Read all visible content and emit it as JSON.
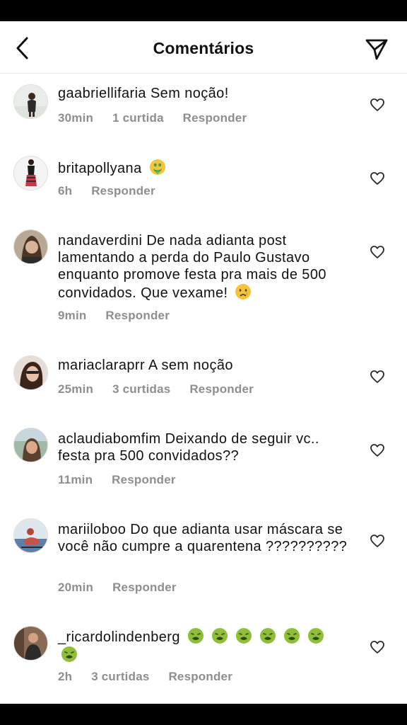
{
  "header": {
    "title": "Comentários",
    "back_icon": "chevron-left-icon",
    "send_icon": "paper-plane-icon"
  },
  "comments": [
    {
      "username": "gaabriellifaria",
      "text": "Sem noção!",
      "emoji": [],
      "time": "30min",
      "likes": "1 curtida",
      "reply": "Responder"
    },
    {
      "username": "britapollyana",
      "text": "",
      "emoji": [
        "money-mouth-face"
      ],
      "time": "6h",
      "likes": "",
      "reply": "Responder"
    },
    {
      "username": "nandaverdini",
      "text": "De nada adianta post lamentando a perda do Paulo Gustavo enquanto promove festa pra mais de 500 convidados. Que vexame!",
      "emoji": [
        "crying-face"
      ],
      "time": "9min",
      "likes": "",
      "reply": "Responder"
    },
    {
      "username": "mariaclaraprr",
      "text": "A sem noção",
      "emoji": [],
      "time": "25min",
      "likes": "3 curtidas",
      "reply": "Responder"
    },
    {
      "username": "aclaudiabomfim",
      "text": "Deixando de seguir vc.. festa pra 500 convidados??",
      "emoji": [],
      "time": "11min",
      "likes": "",
      "reply": "Responder"
    },
    {
      "username": "mariiloboo",
      "text": "Do que adianta usar máscara se você não cumpre a quarentena ??????????",
      "emoji": [],
      "time": "20min",
      "likes": "",
      "reply": "Responder"
    },
    {
      "username": "_ricardolindenberg",
      "text": "",
      "emoji": [
        "nauseated-face",
        "nauseated-face",
        "nauseated-face",
        "nauseated-face",
        "nauseated-face",
        "nauseated-face",
        "nauseated-face"
      ],
      "time": "2h",
      "likes": "3 curtidas",
      "reply": "Responder"
    }
  ],
  "colors": {
    "primary_text": "#111111",
    "meta_text": "#8e8e8e",
    "divider": "#e6e6e6",
    "background": "#ffffff",
    "frame": "#000000"
  }
}
